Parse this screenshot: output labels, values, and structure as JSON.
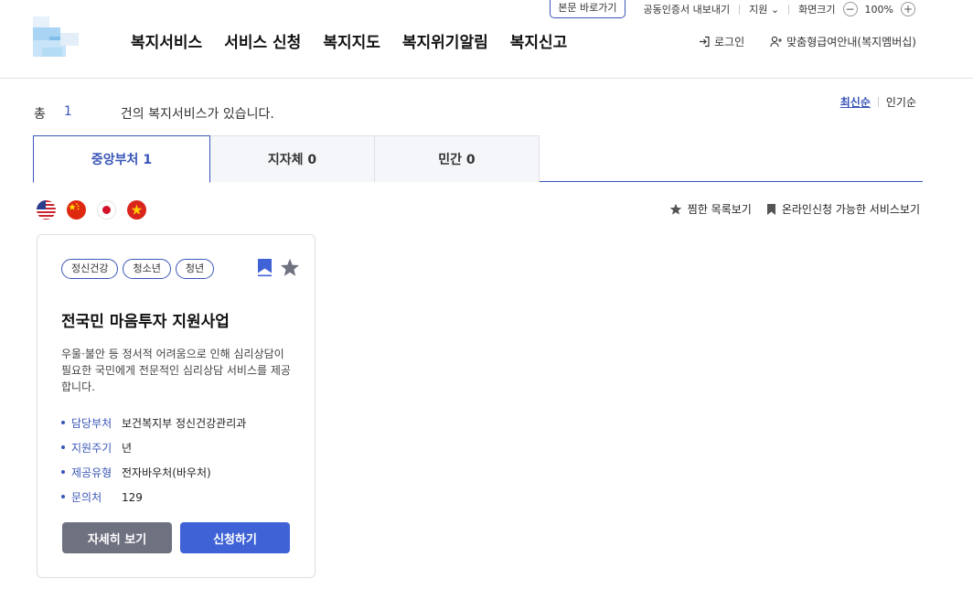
{
  "util": {
    "skip": "본문 바로가기",
    "cert": "공동인증서 내보내기",
    "lang": "지원",
    "zoom_label": "화면크기",
    "zoom_minus": "−",
    "zoom_value": "100%",
    "zoom_plus": "+"
  },
  "gnb": [
    "복지서비스",
    "서비스 신청",
    "복지지도",
    "복지위기알림",
    "복지신고"
  ],
  "header": {
    "login": "로그인",
    "member": "맞춤형급여안내(복지멤버십)"
  },
  "results": {
    "prefix": "총",
    "count": "1",
    "suffix": "건의 복지서비스가 있습니다."
  },
  "sort": {
    "latest": "최신순",
    "popular": "인기순"
  },
  "tabs": [
    {
      "label": "중앙부처 1"
    },
    {
      "label": "지자체 0"
    },
    {
      "label": "민간 0"
    }
  ],
  "flags": [
    "us-flag-icon",
    "china-flag-icon",
    "japan-flag-icon",
    "vietnam-flag-icon"
  ],
  "tools": {
    "favorites": "찜한 목록보기",
    "online": "온라인신청 가능한 서비스보기"
  },
  "card": {
    "tags": [
      "정신건강",
      "청소년",
      "청년"
    ],
    "title": "전국민 마음투자 지원사업",
    "desc": "우울·불안 등 정서적 어려움으로 인해 심리상담이 필요한 국민에게 전문적인 심리상담 서비스를 제공합니다.",
    "info": [
      {
        "k": "담당부처",
        "v": "보건복지부 정신건강관리과"
      },
      {
        "k": "지원주기",
        "v": "년"
      },
      {
        "k": "제공유형",
        "v": "전자바우처(바우처)"
      },
      {
        "k": "문의처",
        "v": "129"
      }
    ],
    "detail_button": "자세히 보기",
    "apply_button": "신청하기"
  },
  "colors": {
    "accent": "#3a56b8",
    "button_apply": "#3f63d6",
    "button_detail": "#6e7180"
  }
}
